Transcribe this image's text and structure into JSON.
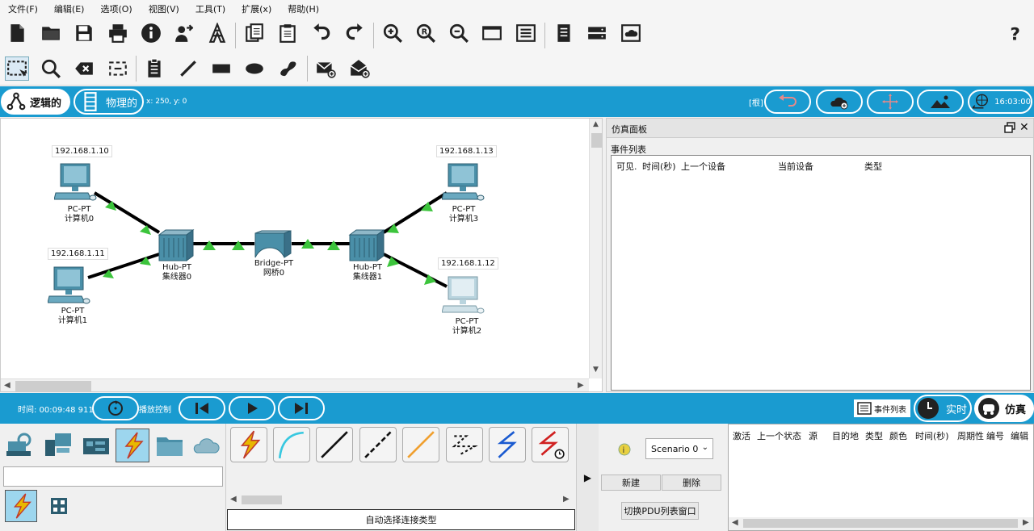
{
  "menu": [
    "文件(F)",
    "编辑(E)",
    "选项(O)",
    "视图(V)",
    "工具(T)",
    "扩展(x)",
    "帮助(H)"
  ],
  "modebar": {
    "logical": "逻辑的",
    "physical": "物理的",
    "coords": "x: 250, y: 0",
    "root": "[根]",
    "clock": "16:03:00"
  },
  "devices": {
    "pc0": {
      "ip": "192.168.1.10",
      "model": "PC-PT",
      "name": "计算机0"
    },
    "pc1": {
      "ip": "192.168.1.11",
      "model": "PC-PT",
      "name": "计算机1"
    },
    "pc2": {
      "ip": "192.168.1.12",
      "model": "PC-PT",
      "name": "计算机2"
    },
    "pc3": {
      "ip": "192.168.1.13",
      "model": "PC-PT",
      "name": "计算机3"
    },
    "hub0": {
      "model": "Hub-PT",
      "name": "集线器0"
    },
    "hub1": {
      "model": "Hub-PT",
      "name": "集线器1"
    },
    "bridge0": {
      "model": "Bridge-PT",
      "name": "网桥0"
    }
  },
  "sim_panel": {
    "title": "仿真面板",
    "event_list": "事件列表",
    "columns": [
      "可见.",
      "时间(秒)",
      "上一个设备",
      "当前设备",
      "类型"
    ]
  },
  "transport": {
    "time": "时间: 00:09:48 911",
    "playback": "播放控制",
    "event_list_btn": "事件列表",
    "realtime": "实时",
    "simulation": "仿真"
  },
  "bottom": {
    "auto_connect": "自动选择连接类型",
    "scenario": "Scenario 0",
    "new_btn": "新建",
    "delete_btn": "删除",
    "toggle_pdu": "切换PDU列表窗口",
    "pdu_columns": [
      "激活",
      "上一个状态",
      "源",
      "目的地",
      "类型",
      "颜色",
      "时间(秒)",
      "周期性",
      "编号",
      "编辑"
    ]
  },
  "colors": {
    "accent": "#1a9bd0",
    "link_light": "#3cc43c",
    "cable": "#000000"
  }
}
